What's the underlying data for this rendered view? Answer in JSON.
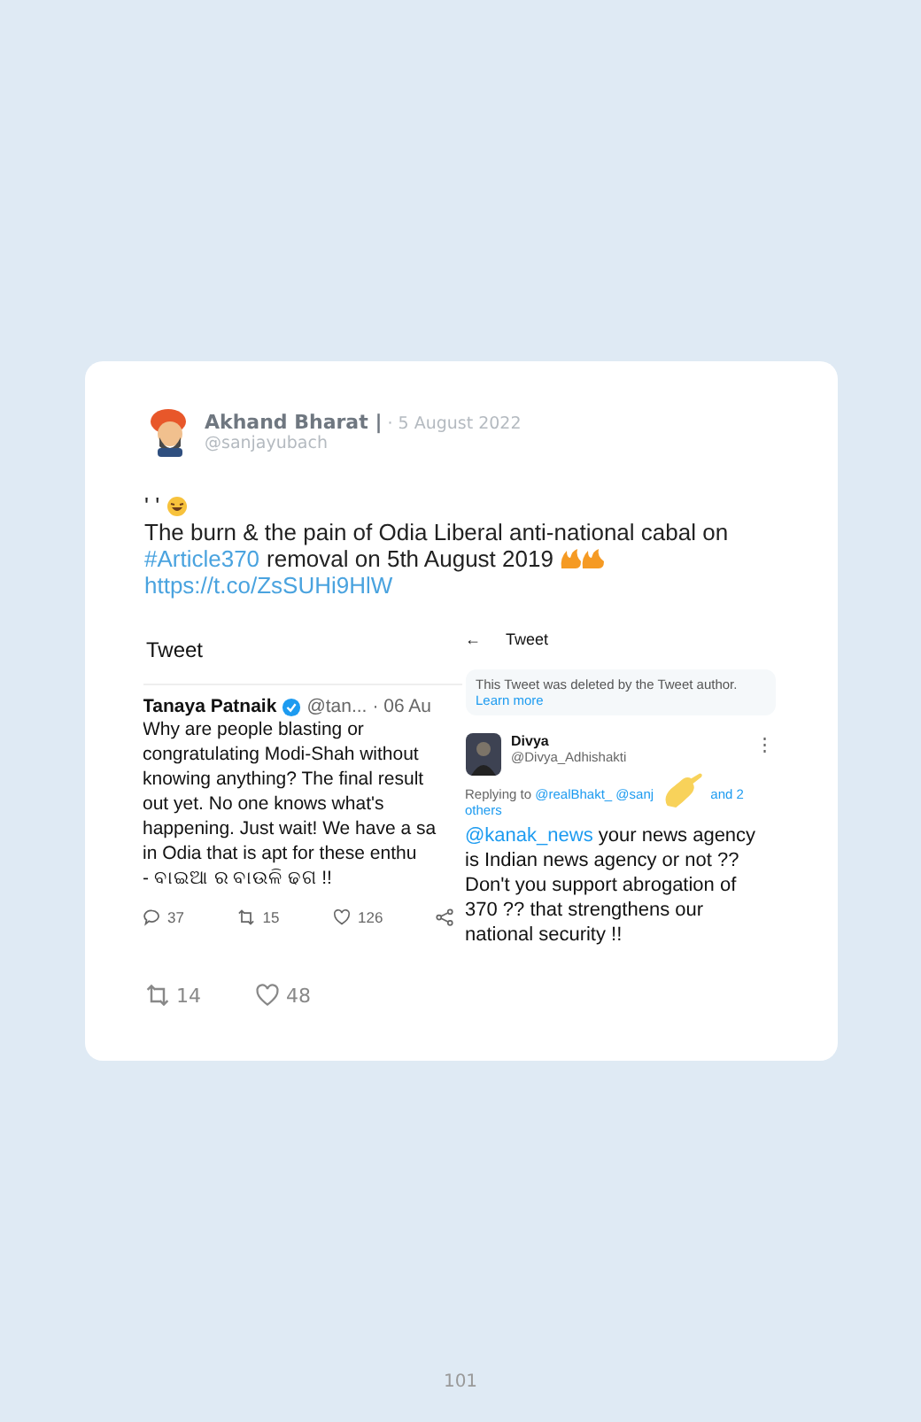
{
  "post": {
    "author": "Akhand Bharat |",
    "date": "· 5 August 2022",
    "handle": "@sanjayubach",
    "prefix": "' '",
    "text_line1": "The burn & the pain of Odia Liberal anti-national cabal on",
    "hashtag": "#Article370",
    "text_line2": "removal on 5th August 2019",
    "link": "https://t.co/ZsSUHi9HlW",
    "retweets": "14",
    "likes": "48"
  },
  "left_shot": {
    "header": "Tweet",
    "name": "Tanaya Patnaik",
    "verified": true,
    "handle": "@tan...",
    "date": "· 06 Au",
    "lines": [
      "Why are people blasting or",
      "congratulating Modi-Shah without",
      "knowing anything? The final result",
      "out yet. No one knows what's",
      "happening. Just wait! We have a sa",
      "in Odia that is apt for these enthu",
      "- ବାଇଆ ର ବାଉଳି ଢଗ !!"
    ],
    "replies": "37",
    "retweets": "15",
    "likes": "126"
  },
  "right_shot": {
    "back": "←",
    "header": "Tweet",
    "notice": "This Tweet was deleted by the Tweet author.",
    "learn_more": "Learn more",
    "name": "Divya",
    "handle": "@Divya_Adhishakti",
    "more": "⋮",
    "replying_to": "Replying to",
    "reply_handles": "@realBhakt_ @sanj",
    "reply_rest": "and 2",
    "reply_rest2": "others",
    "mention": "@kanak_news",
    "lines": [
      "your news agency",
      "is Indian news agency or not ??",
      "Don't you support abrogation of",
      "370 ?? that strengthens our",
      "national security !!"
    ]
  },
  "page_number": "101"
}
